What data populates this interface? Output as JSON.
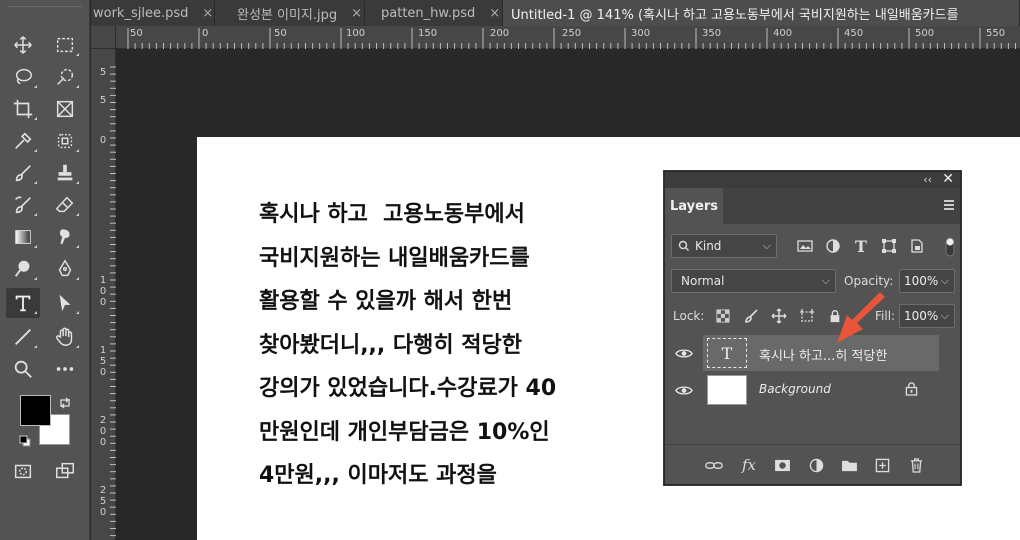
{
  "tabs": [
    {
      "label": "work_sjlee.psd",
      "close": "×",
      "active": false
    },
    {
      "label": "완성본 이미지.jpg",
      "close": "×",
      "active": false
    },
    {
      "label": "patten_hw.psd",
      "close": "×",
      "active": false
    },
    {
      "label": "Untitled-1 @ 141% (혹시나 하고  고용노동부에서 국비지원하는 내일배움카드를",
      "close": "",
      "active": true
    }
  ],
  "ruler": {
    "top_labels": [
      "50",
      "0",
      "50",
      "100",
      "150",
      "200",
      "250",
      "300",
      "350",
      "400",
      "450",
      "500",
      "550"
    ],
    "left_labels": [
      "5",
      "5",
      "0",
      "1 0 0",
      "1 5 0",
      "2 0 0",
      "2 5 0"
    ]
  },
  "document": {
    "lines": [
      "혹시나 하고  고용노동부에서",
      "국비지원하는 내일배움카드를",
      "활용할 수 있을까 해서 한번",
      "찾아봤더니,,, 다행히 적당한",
      "강의가 있었습니다.수강료가 40",
      "만원인데 개인부담금은 10%인",
      "4만원,,, 이마저도 과정을"
    ]
  },
  "layers_panel": {
    "title": "Layers",
    "collapse": "‹‹",
    "close": "✕",
    "filter_kind": "Kind",
    "blend_mode": "Normal",
    "opacity_label": "Opacity:",
    "opacity_value": "100%",
    "lock_label": "Lock:",
    "fill_label": "Fill:",
    "fill_value": "100%",
    "layers": [
      {
        "name": "혹시나 하고...히 적당한",
        "type": "text",
        "thumb_glyph": "T",
        "selected": true
      },
      {
        "name": "Background",
        "type": "background",
        "selected": false
      }
    ]
  },
  "colors": {
    "foreground": "#000000",
    "background": "#ffffff",
    "annotation_arrow": "#e8553a"
  }
}
